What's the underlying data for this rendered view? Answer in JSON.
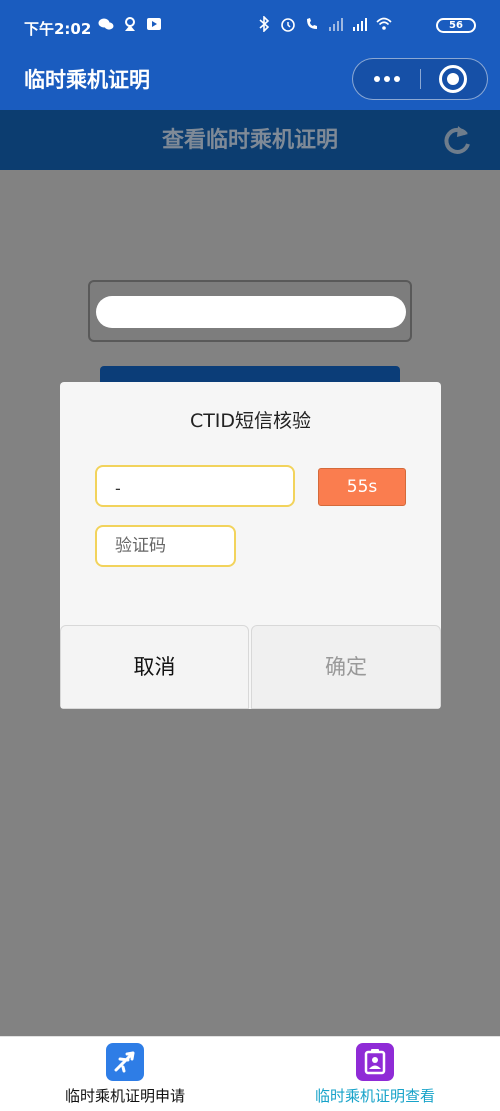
{
  "status_bar": {
    "time": "下午2:02",
    "battery": "56"
  },
  "app_bar": {
    "title": "临时乘机证明"
  },
  "page": {
    "subtitle": "查看临时乘机证明"
  },
  "dialog": {
    "title": "CTID短信核验",
    "phone_value": "-",
    "countdown_label": "55s",
    "code_placeholder": "验证码",
    "cancel_label": "取消",
    "confirm_label": "确定"
  },
  "tabbar": {
    "items": [
      {
        "label": "临时乘机证明申请",
        "icon": "airplane-icon"
      },
      {
        "label": "临时乘机证明查看",
        "icon": "certificate-icon"
      }
    ]
  },
  "colors": {
    "header_blue": "#1a5cbf",
    "countdown_orange": "#fa7d4f",
    "field_border": "#f2d35c",
    "active_tab_text": "#17a3c9"
  }
}
